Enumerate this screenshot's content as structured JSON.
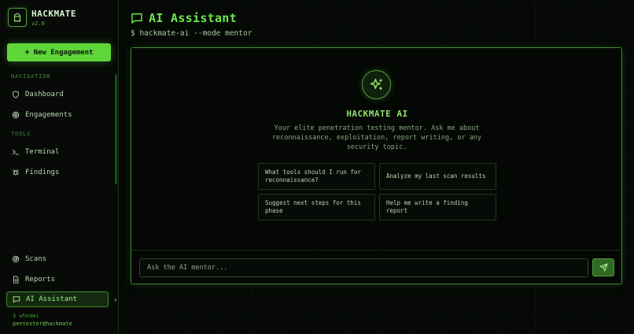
{
  "app": {
    "name": "HACKMATE",
    "version": "v2.0",
    "logo_icon": "ghost-icon"
  },
  "sidebar": {
    "new_button_label": "New Engagement",
    "sections": {
      "navigation": "NAVIGATION",
      "tools": "TOOLS"
    },
    "items": [
      {
        "label": "Dashboard",
        "icon": "shield-icon"
      },
      {
        "label": "Engagements",
        "icon": "target-icon"
      },
      {
        "label": "Terminal",
        "icon": "terminal-icon"
      },
      {
        "label": "Findings",
        "icon": "bug-icon"
      },
      {
        "label": "Scans",
        "icon": "radar-icon"
      },
      {
        "label": "Reports",
        "icon": "document-icon"
      },
      {
        "label": "AI Assistant",
        "icon": "chat-icon",
        "active": true
      }
    ],
    "whoami_cmd": "$ whoami",
    "whoami_user": "pentester@hackmate"
  },
  "main": {
    "title": "AI Assistant",
    "command": "$ hackmate-ai --mode mentor",
    "assistant": {
      "name": "HACKMATE AI",
      "description": "Your elite penetration testing mentor. Ask me about reconnaissance, exploitation, report writing, or any security topic.",
      "suggestions": [
        "What tools should I run for reconnaissance?",
        "Analyze my last scan results",
        "Suggest next steps for this phase",
        "Help me write a finding report"
      ]
    },
    "input": {
      "placeholder": "Ask the AI mentor...",
      "value": ""
    }
  },
  "colors": {
    "accent": "#5ed63a",
    "title": "#6ee84c",
    "background": "#050805",
    "border": "#3f8c2e"
  }
}
